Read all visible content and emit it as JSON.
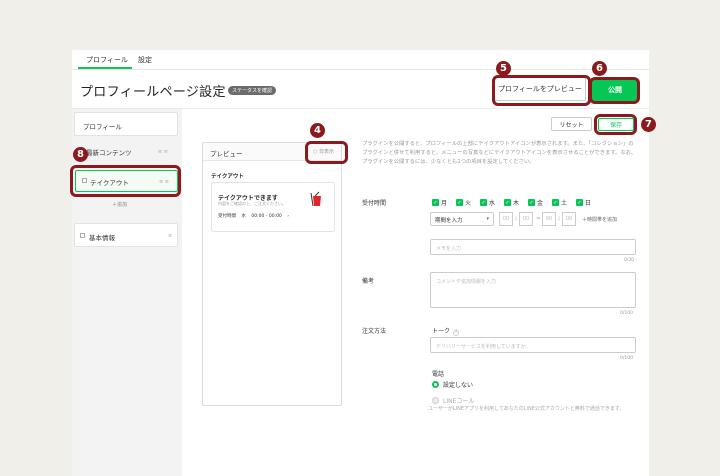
{
  "nav": {
    "tabs": [
      "プロフィール",
      "設定"
    ]
  },
  "header": {
    "title": "プロフィールページ設定",
    "badge": "ステータスを確認",
    "preview_button": "プロフィールをプレビュー",
    "publish_button": "公開"
  },
  "sidebar": {
    "profile": "プロフィール",
    "section": "最新コンテンツ",
    "takeout": "テイクアウト",
    "add": "＋追加",
    "basic": "基本情報"
  },
  "preview": {
    "title": "プレビュー",
    "close": "○ 非表示",
    "section": "テイクアウト",
    "card_title": "テイクアウトできます",
    "card_sub": "内容をご確認の上、ご注文ください。",
    "hours_label": "受付時間",
    "hours_day": "水",
    "hours_time": "00:00 - 00:00",
    "hours_arrow": "›"
  },
  "toolbar": {
    "reset": "リセット",
    "save": "保存"
  },
  "form": {
    "description": "プラグインを公開すると、プロフィールの上部にテイクアウトアイコンが表示されます。また、「コレクション」のプラグインと併せて利用すると、メニューの写真などにテイクアウトアイコンを表示させることができます。なお、プラグインを公開するには、少なくとも1つの項目を設定してください。",
    "hours_label": "受付時間",
    "days": [
      "月",
      "火",
      "水",
      "木",
      "金",
      "土",
      "日"
    ],
    "period_select": "期間を入力",
    "add_time": "＋時間帯を追加",
    "memo_placeholder": "メモを入力",
    "memo_count": "0/30",
    "notes_label": "備考",
    "notes_placeholder": "コメントや追加情報を入力",
    "notes_count": "0/100",
    "order_label": "注文方法",
    "talk_label": "トーク",
    "talk_placeholder": "デリバリーサービスを利用していますか。",
    "talk_count": "0/100",
    "phone_label": "電話",
    "phone_none": "設定しない",
    "line_call": "LINEコール",
    "line_call_desc": "ユーザーがLINEアプリを利用してあなたのLINE公式アカウントと無料で通話できます。"
  },
  "annotations": [
    "4",
    "5",
    "6",
    "7",
    "8"
  ],
  "colors": {
    "accent": "#06c755",
    "annotation": "#8b1a1f"
  }
}
